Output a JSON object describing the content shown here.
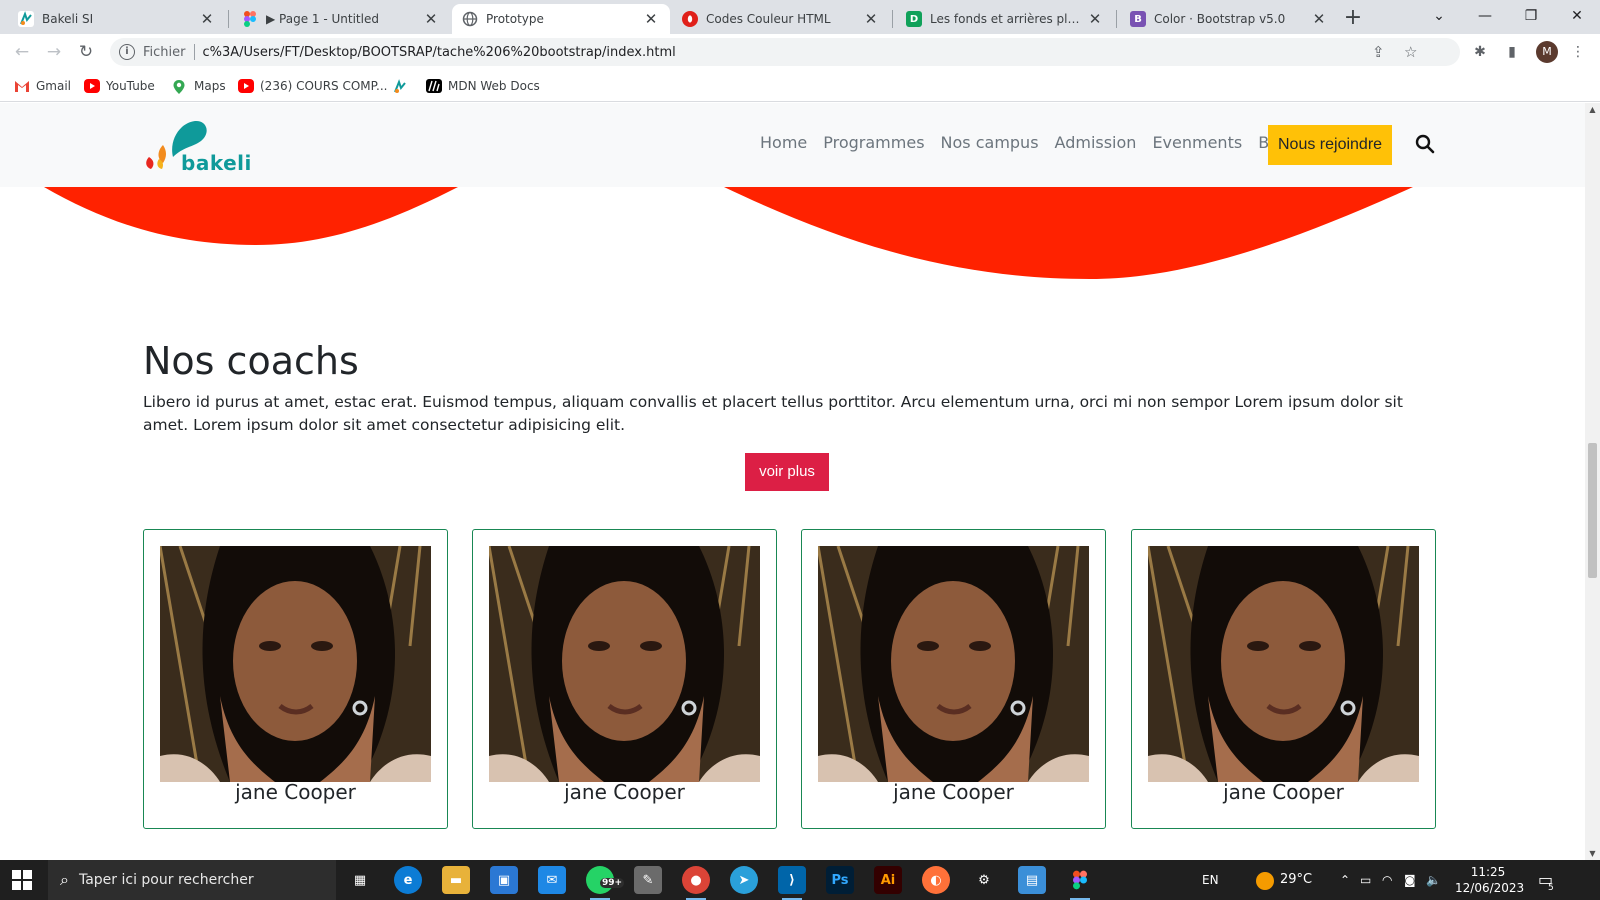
{
  "browser": {
    "tabs": [
      {
        "title": "Bakeli SI",
        "favicon": "bakeli-icon",
        "color": "#0f9a9a",
        "active": false
      },
      {
        "title": "▶ Page 1 - Untitled",
        "favicon": "figma-icon",
        "color": "#f24e1e",
        "active": false
      },
      {
        "title": "Prototype",
        "favicon": "globe-icon",
        "color": "#5f6368",
        "active": true
      },
      {
        "title": "Codes Couleur HTML",
        "favicon": "opera-icon",
        "color": "#e0201a",
        "active": false
      },
      {
        "title": "Les fonds et arrières plans CSS",
        "favicon": "d-icon",
        "color": "#10a15a",
        "active": false
      },
      {
        "title": "Color · Bootstrap v5.0",
        "favicon": "bootstrap-icon",
        "color": "#7952b3",
        "active": false
      }
    ],
    "address": {
      "scheme_label": "Fichier",
      "url": "c%3A/Users/FT/Desktop/BOOTSRAP/tache%206%20bootstrap/index.html"
    },
    "avatar_initial": "M",
    "bookmarks": [
      {
        "label": "Gmail",
        "icon": "gmail-icon",
        "color": "#ea4335"
      },
      {
        "label": "YouTube",
        "icon": "youtube-icon",
        "color": "#ff0000"
      },
      {
        "label": "Maps",
        "icon": "maps-icon",
        "color": "#34a853"
      },
      {
        "label": "(236) COURS COMP...",
        "icon": "youtube-icon",
        "color": "#ff0000"
      },
      {
        "label": "",
        "icon": "bakeli-icon",
        "color": "#0f9a9a"
      },
      {
        "label": "MDN Web Docs",
        "icon": "mdn-icon",
        "color": "#000000"
      }
    ]
  },
  "site": {
    "logo_text": "bakeli",
    "nav": [
      "Home",
      "Programmes",
      "Nos campus",
      "Admission",
      "Evenments",
      "Blog"
    ],
    "join_label": "Nous rejoindre",
    "accent_yellow": "#ffc107",
    "accent_red": "#ff2200"
  },
  "coachs": {
    "title": "Nos coachs",
    "text": "Libero id purus at amet, estac erat. Euismod tempus, aliquam convallis et placert tellus porttitor. Arcu elementum urna, orci mi non sempor Lorem ipsum dolor sit amet. Lorem ipsum dolor sit amet consectetur adipisicing elit.",
    "button_label": "voir plus",
    "button_color": "#dc1f45",
    "cards": [
      {
        "name": "jane Cooper"
      },
      {
        "name": "jane Cooper"
      },
      {
        "name": "jane Cooper"
      },
      {
        "name": "jane Cooper"
      }
    ]
  },
  "taskbar": {
    "search_placeholder": "Taper ici pour rechercher",
    "whatsapp_badge": "99+",
    "language": "EN",
    "temperature": "29°C",
    "time": "11:25",
    "date": "12/06/2023",
    "notification_count": "5"
  }
}
